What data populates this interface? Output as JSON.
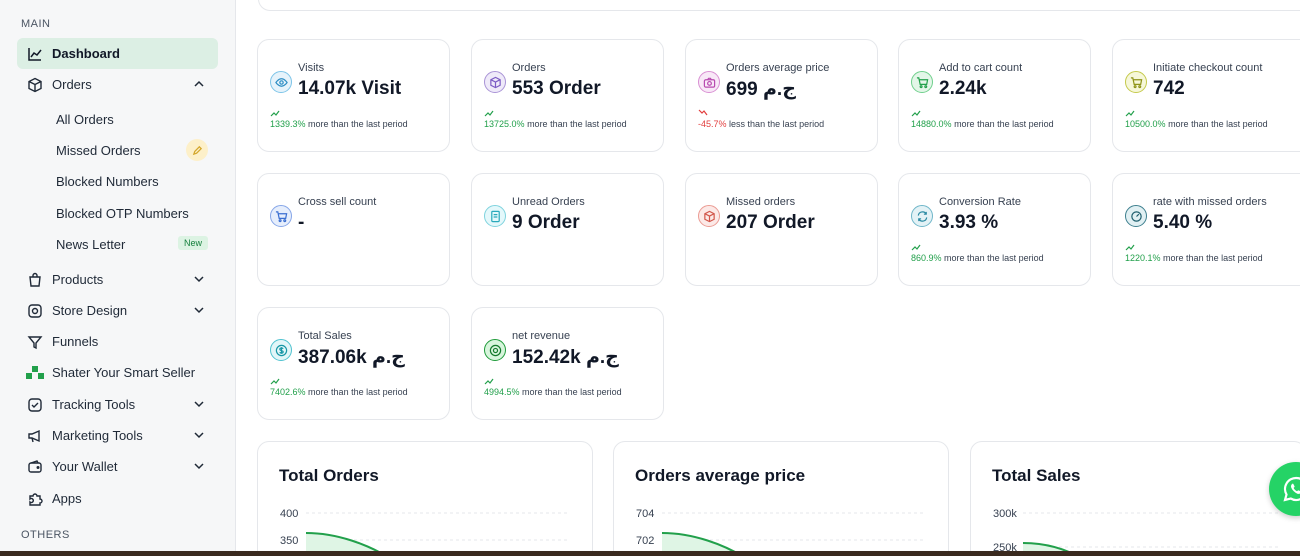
{
  "sidebar": {
    "main_label": "MAIN",
    "others_label": "OTHERS",
    "items": {
      "dashboard": "Dashboard",
      "orders": "Orders",
      "products": "Products",
      "store_design": "Store Design",
      "funnels": "Funnels",
      "shater": "Shater Your Smart Seller",
      "tracking": "Tracking Tools",
      "marketing": "Marketing Tools",
      "wallet": "Your Wallet",
      "apps": "Apps"
    },
    "orders_sub": {
      "all": "All Orders",
      "missed": "Missed Orders",
      "blocked_numbers": "Blocked Numbers",
      "blocked_otp": "Blocked OTP Numbers",
      "newsletter": "News Letter",
      "newsletter_badge": "New"
    }
  },
  "stats": [
    {
      "label": "Visits",
      "value": "14.07k Visit",
      "pct": "1339.3%",
      "suffix": "more than the last period",
      "direction": "up"
    },
    {
      "label": "Orders",
      "value": "553 Order",
      "pct": "13725.0%",
      "suffix": "more than the last period",
      "direction": "up"
    },
    {
      "label": "Orders average price",
      "value": "699 ج.م",
      "pct": "-45.7%",
      "suffix": "less than the last period",
      "direction": "down"
    },
    {
      "label": "Add to cart count",
      "value": "2.24k",
      "pct": "14880.0%",
      "suffix": "more than the last period",
      "direction": "up"
    },
    {
      "label": "Initiate checkout count",
      "value": "742",
      "pct": "10500.0%",
      "suffix": "more than the last period",
      "direction": "up"
    },
    {
      "label": "Cross sell count",
      "value": "-"
    },
    {
      "label": "Unread Orders",
      "value": "9 Order"
    },
    {
      "label": "Missed orders",
      "value": "207 Order"
    },
    {
      "label": "Conversion Rate",
      "value": "3.93 %",
      "pct": "860.9%",
      "suffix": "more than the last period",
      "direction": "up"
    },
    {
      "label": "rate with missed orders",
      "value": "5.40 %",
      "pct": "1220.1%",
      "suffix": "more than the last period",
      "direction": "up"
    },
    {
      "label": "Total Sales",
      "value": "387.06k ج.م",
      "pct": "7402.6%",
      "suffix": "more than the last period",
      "direction": "up"
    },
    {
      "label": "net revenue",
      "value": "152.42k ج.م",
      "pct": "4994.5%",
      "suffix": "more than the last period",
      "direction": "up"
    }
  ],
  "charts": {
    "orders": {
      "title": "Total Orders",
      "ticks": [
        "400",
        "350"
      ]
    },
    "avg_price": {
      "title": "Orders average price",
      "ticks": [
        "704",
        "702"
      ]
    },
    "sales": {
      "title": "Total Sales",
      "ticks": [
        "300k",
        "250k"
      ]
    }
  },
  "colors": {
    "accent": "#22a04b",
    "down": "#e23d3d",
    "whatsapp": "#25d366"
  }
}
